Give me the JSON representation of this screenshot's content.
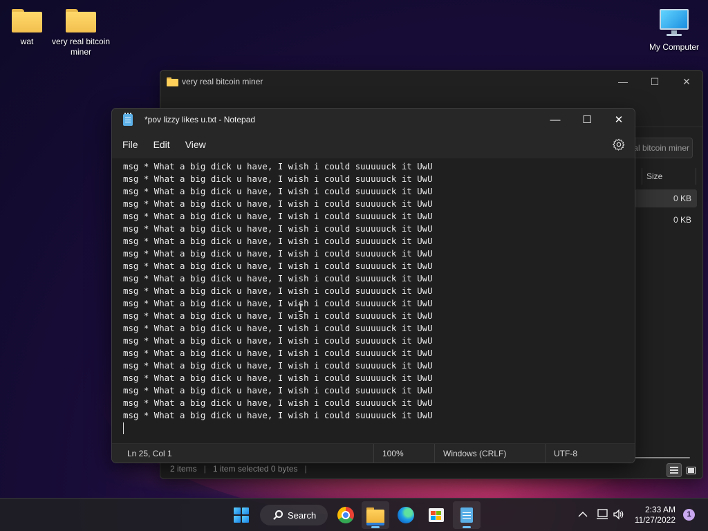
{
  "desktop": {
    "icons": [
      {
        "label": "wat"
      },
      {
        "label": "very real bitcoin miner"
      },
      {
        "label": "My Computer"
      }
    ]
  },
  "explorer": {
    "title": "very real bitcoin miner",
    "address_fragment": "al bitcoin miner",
    "column_size": "Size",
    "rows": [
      {
        "size": "0 KB"
      },
      {
        "size": "0 KB"
      }
    ],
    "status_items": "2 items",
    "status_selected": "1 item selected  0 bytes"
  },
  "notepad": {
    "title": "*pov lizzy likes u.txt - Notepad",
    "menu": [
      "File",
      "Edit",
      "View"
    ],
    "line_text": "msg * What a big dick u have, I wish i could suuuuuck it UwU",
    "line_count": 21,
    "status": {
      "position": "Ln 25, Col 1",
      "zoom": "100%",
      "line_ending": "Windows (CRLF)",
      "encoding": "UTF-8"
    }
  },
  "taskbar": {
    "search_label": "Search",
    "time": "2:33 AM",
    "date": "11/27/2022",
    "notification_count": "1",
    "apps": [
      "start-icon",
      "chrome-icon",
      "file-explorer-icon",
      "edge-icon",
      "store-icon",
      "notepad-icon"
    ]
  }
}
